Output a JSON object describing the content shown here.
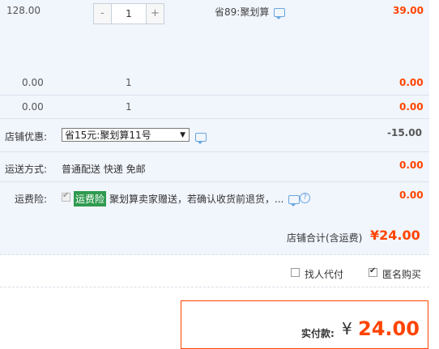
{
  "item": {
    "unit_price": "128.00",
    "quantity": "1",
    "minus": "-",
    "plus": "+",
    "discount_note": "省89:聚划算",
    "subtotal": "39.00"
  },
  "extra_rows": [
    {
      "price": "0.00",
      "quantity": "1",
      "subtotal": "0.00"
    },
    {
      "price": "0.00",
      "quantity": "1",
      "subtotal": "0.00"
    }
  ],
  "shop_coupon": {
    "label": "店铺优惠:",
    "selected": "省15元:聚划算11号",
    "arrow": "▼",
    "amount": "-15.00"
  },
  "shipping": {
    "label": "运送方式:",
    "value": "普通配送 快递 免邮",
    "amount": "0.00"
  },
  "insurance": {
    "label": "运费险:",
    "tag": "运费险",
    "text": "聚划算卖家赠送，若确认收货前退货，...",
    "amount": "0.00",
    "help": "?"
  },
  "shop_total": {
    "label": "店铺合计(含运费)",
    "amount": "¥24.00"
  },
  "options": {
    "proxy_pay": "找人代付",
    "anonymous": "匿名购买"
  },
  "payment": {
    "label": "实付款:",
    "currency": "¥",
    "amount": "24.00"
  },
  "colors": {
    "price_red": "#ff4400",
    "panel_bg": "#f1f5fc",
    "tag_green": "#2f9a4f",
    "chat_blue": "#6aa6e0"
  }
}
